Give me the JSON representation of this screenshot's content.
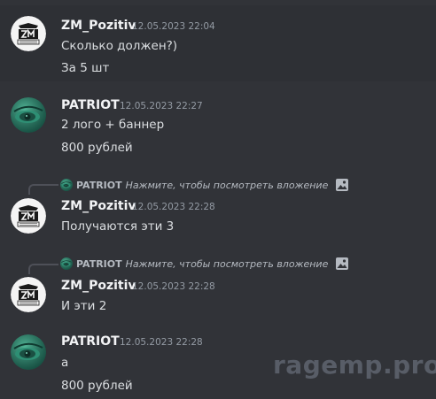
{
  "messages": [
    {
      "author": "ZM_Pozitiv",
      "timestamp": "12.05.2023 22:04",
      "lines": [
        "Сколько должен?)",
        "За 5 шт"
      ]
    },
    {
      "author": "PATRIOT",
      "timestamp": "12.05.2023 22:27",
      "lines": [
        "2 лого + баннер",
        "800 рублей"
      ]
    },
    {
      "reply": {
        "author": "PATRIOT",
        "text": "Нажмите, чтобы посмотреть вложение",
        "icon": "image-icon"
      },
      "author": "ZM_Pozitiv",
      "timestamp": "12.05.2023 22:28",
      "lines": [
        "Получаются эти 3"
      ]
    },
    {
      "reply": {
        "author": "PATRIOT",
        "text": "Нажмите, чтобы посмотреть вложение",
        "icon": "image-icon"
      },
      "author": "ZM_Pozitiv",
      "timestamp": "12.05.2023 22:28",
      "lines": [
        "И эти 2"
      ]
    },
    {
      "author": "PATRIOT",
      "timestamp": "12.05.2023 22:28",
      "lines": [
        "а",
        "800 рублей"
      ]
    }
  ],
  "watermark": "ragemp.pro",
  "colors": {
    "background": "#313338",
    "hover_background": "#2e3035",
    "username": "#f2f3f5",
    "text": "#dbdee1",
    "timestamp": "#949ba4"
  }
}
